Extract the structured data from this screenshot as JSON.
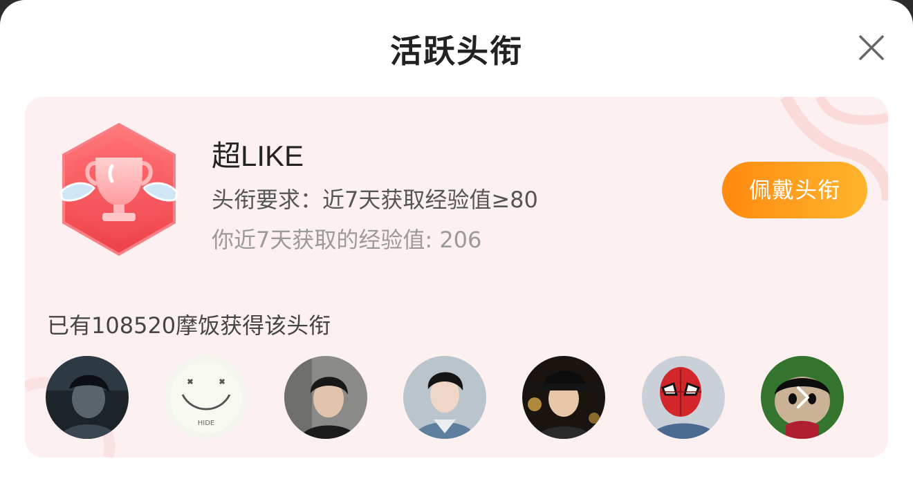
{
  "header": {
    "title": "活跃头衔",
    "close_icon": "close-icon"
  },
  "title_card": {
    "badge_icon": "trophy-badge-icon",
    "name": "超LIKE",
    "requirement": "头衔要求：近7天获取经验值≥80",
    "my_experience": "你近7天获取的经验值: 206",
    "wear_button": "佩戴头衔",
    "holders_text": "已有108520摩饭获得该头衔",
    "holders": [
      {
        "name": "holder-avatar-1"
      },
      {
        "name": "holder-avatar-2"
      },
      {
        "name": "holder-avatar-3"
      },
      {
        "name": "holder-avatar-4"
      },
      {
        "name": "holder-avatar-5"
      },
      {
        "name": "holder-avatar-6"
      },
      {
        "name": "holder-avatar-7"
      }
    ],
    "smiley_caption": "HIDE",
    "more_icon": "chevron-right-icon"
  },
  "colors": {
    "card_bg": "#fdf0f0",
    "button_start": "#ff8a10",
    "button_end": "#ffb52e",
    "badge_red": "#f2555a"
  }
}
